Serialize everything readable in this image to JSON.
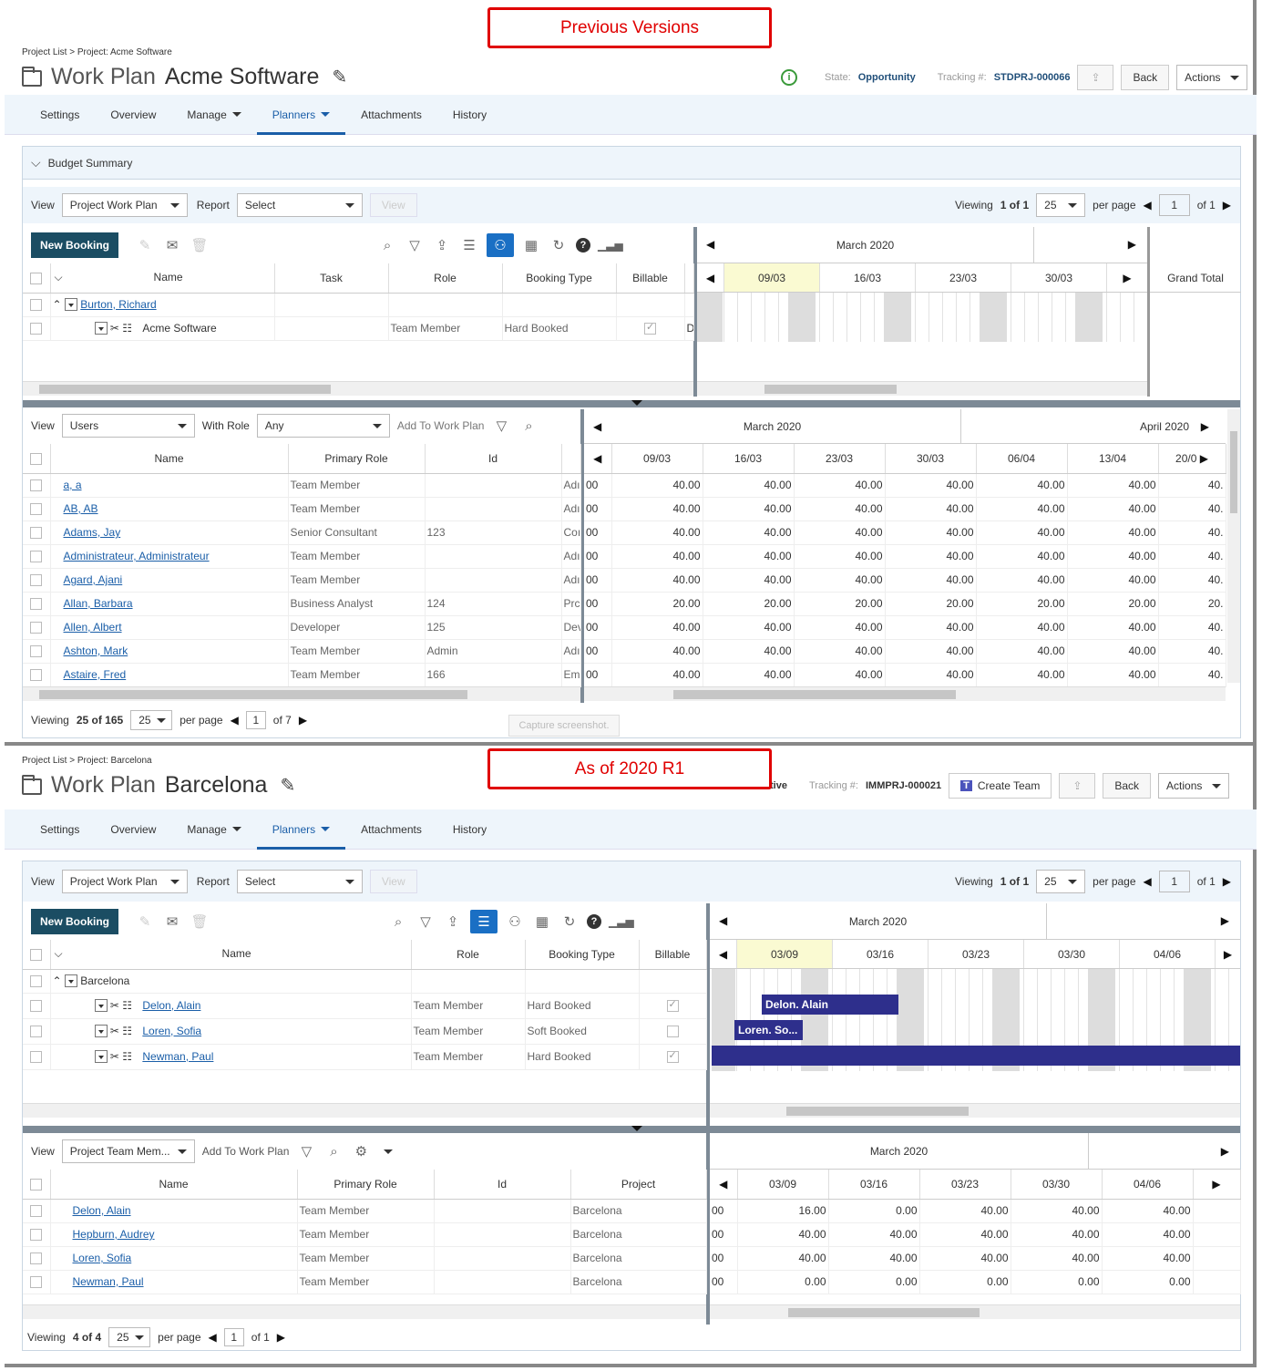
{
  "callouts": {
    "top": "Previous Versions",
    "bottom": "As of 2020 R1"
  },
  "common": {
    "tabs": [
      {
        "label": "Settings"
      },
      {
        "label": "Overview"
      },
      {
        "label": "Manage"
      },
      {
        "label": "Planners"
      },
      {
        "label": "Attachments"
      },
      {
        "label": "History"
      }
    ],
    "view_label": "View",
    "report_label": "Report",
    "view_select": "Project Work Plan",
    "report_select": "Select",
    "view_button": "View",
    "back": "Back",
    "actions": "Actions",
    "new_booking": "New Booking",
    "viewing_label": "Viewing",
    "of_label": "of",
    "per_page": "per page",
    "page_size": "25",
    "work_plan_label": "Work Plan"
  },
  "top": {
    "breadcrumb": "Project List > Project: Acme Software",
    "project_name": "Acme Software",
    "state_label": "State:",
    "state_value": "Opportunity",
    "tracking_label": "Tracking #:",
    "tracking_value": "STDPRJ-000066",
    "budget_summary": "Budget Summary",
    "viewing_summary": "1 of 1",
    "page_of": "of 1",
    "page_number": "1",
    "columns": [
      "Name",
      "Task",
      "Role",
      "Booking Type",
      "Billable"
    ],
    "gantt_month": "March 2020",
    "gantt_weeks": [
      "09/03",
      "16/03",
      "23/03",
      "30/03"
    ],
    "grand_total": "Grand Total",
    "rows": [
      {
        "name": "Burton, Richard",
        "type": "group"
      },
      {
        "name": "Acme Software",
        "role": "Team Member",
        "booking": "Hard Booked",
        "billable": true,
        "extra": "D"
      }
    ],
    "resources": {
      "view_select": "Users",
      "with_role_label": "With Role",
      "role_select": "Any",
      "add_to_work_plan": "Add To Work Plan",
      "columns": [
        "Name",
        "Primary Role",
        "Id"
      ],
      "months": [
        "March 2020",
        "April 2020"
      ],
      "weeks": [
        "09/03",
        "16/03",
        "23/03",
        "30/03",
        "06/04",
        "13/04",
        "20/0"
      ],
      "rows": [
        {
          "name": "a, a",
          "role": "Team Member",
          "id": "",
          "cut": "Adı",
          "values": [
            "40.00",
            "40.00",
            "40.00",
            "40.00",
            "40.00",
            "40.00",
            "40."
          ]
        },
        {
          "name": "AB, AB",
          "role": "Team Member",
          "id": "",
          "cut": "Adı",
          "values": [
            "40.00",
            "40.00",
            "40.00",
            "40.00",
            "40.00",
            "40.00",
            "40."
          ]
        },
        {
          "name": "Adams, Jay",
          "role": "Senior Consultant",
          "id": "123",
          "cut": "Coı",
          "values": [
            "40.00",
            "40.00",
            "40.00",
            "40.00",
            "40.00",
            "40.00",
            "40."
          ]
        },
        {
          "name": "Administrateur, Administrateur",
          "role": "Team Member",
          "id": "",
          "cut": "Adı",
          "values": [
            "40.00",
            "40.00",
            "40.00",
            "40.00",
            "40.00",
            "40.00",
            "40."
          ]
        },
        {
          "name": "Agard, Ajani",
          "role": "Team Member",
          "id": "",
          "cut": "Adı",
          "values": [
            "40.00",
            "40.00",
            "40.00",
            "40.00",
            "40.00",
            "40.00",
            "40."
          ]
        },
        {
          "name": "Allan, Barbara",
          "role": "Business Analyst",
          "id": "124",
          "cut": "Prc",
          "values": [
            "20.00",
            "20.00",
            "20.00",
            "20.00",
            "20.00",
            "20.00",
            "20."
          ]
        },
        {
          "name": "Allen, Albert",
          "role": "Developer",
          "id": "125",
          "cut": "Dev",
          "values": [
            "40.00",
            "40.00",
            "40.00",
            "40.00",
            "40.00",
            "40.00",
            "40."
          ]
        },
        {
          "name": "Ashton, Mark",
          "role": "Team Member",
          "id": "Admin",
          "cut": "Adı",
          "values": [
            "40.00",
            "40.00",
            "40.00",
            "40.00",
            "40.00",
            "40.00",
            "40."
          ]
        },
        {
          "name": "Astaire, Fred",
          "role": "Team Member",
          "id": "166",
          "cut": "Em",
          "values": [
            "40.00",
            "40.00",
            "40.00",
            "40.00",
            "40.00",
            "40.00",
            "40."
          ]
        }
      ],
      "cut_prefix": "00",
      "viewing": "25 of 165",
      "page_number": "1",
      "page_of": "of 7"
    },
    "tooltip": "Capture screenshot."
  },
  "bottom": {
    "breadcrumb": "Project List > Project: Barcelona",
    "project_name": "Barcelona",
    "state_fragment": "tive",
    "tracking_label": "Tracking #:",
    "tracking_value": "IMMPRJ-000021",
    "create_team": "Create Team",
    "viewing_summary": "1 of 1",
    "page_of": "of 1",
    "page_number": "1",
    "columns": [
      "Name",
      "Role",
      "Booking Type",
      "Billable"
    ],
    "gantt_month": "March 2020",
    "gantt_weeks": [
      "03/09",
      "03/16",
      "03/23",
      "03/30",
      "04/06"
    ],
    "rows": [
      {
        "name": "Barcelona",
        "type": "group"
      },
      {
        "name": "Delon, Alain",
        "role": "Team Member",
        "booking": "Hard Booked",
        "billable": true,
        "bar": "Delon. Alain"
      },
      {
        "name": "Loren, Sofia",
        "role": "Team Member",
        "booking": "Soft Booked",
        "billable": false,
        "bar": "Loren. So..."
      },
      {
        "name": "Newman, Paul",
        "role": "Team Member",
        "booking": "Hard Booked",
        "billable": true,
        "bar": ""
      }
    ],
    "resources": {
      "view_select": "Project Team Mem...",
      "add_to_work_plan": "Add To Work Plan",
      "columns": [
        "Name",
        "Primary Role",
        "Id",
        "Project"
      ],
      "month": "March 2020",
      "weeks": [
        "03/09",
        "03/16",
        "03/23",
        "03/30",
        "04/06"
      ],
      "rows": [
        {
          "name": "Delon, Alain",
          "role": "Team Member",
          "id": "",
          "project": "Barcelona",
          "values": [
            "16.00",
            "0.00",
            "40.00",
            "40.00",
            "40.00"
          ]
        },
        {
          "name": "Hepburn, Audrey",
          "role": "Team Member",
          "id": "",
          "project": "Barcelona",
          "values": [
            "40.00",
            "40.00",
            "40.00",
            "40.00",
            "40.00"
          ]
        },
        {
          "name": "Loren, Sofia",
          "role": "Team Member",
          "id": "",
          "project": "Barcelona",
          "values": [
            "40.00",
            "40.00",
            "40.00",
            "40.00",
            "40.00"
          ]
        },
        {
          "name": "Newman, Paul",
          "role": "Team Member",
          "id": "",
          "project": "Barcelona",
          "values": [
            "0.00",
            "0.00",
            "0.00",
            "0.00",
            "0.00"
          ]
        }
      ],
      "cut_prefix": "00",
      "viewing": "4 of 4",
      "page_number": "1",
      "page_of": "of 1"
    }
  },
  "colors": {
    "accent": "#1a5ea8",
    "button_dark": "#1b4d63",
    "gantt_bar": "#2e2f8c",
    "callout": "#e00000"
  }
}
